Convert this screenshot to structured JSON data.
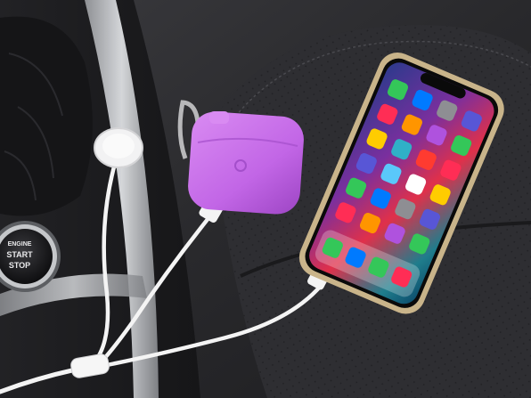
{
  "engine_button": {
    "line1": "ENGINE",
    "line2": "START",
    "line3": "STOP"
  },
  "colors": {
    "seat_leather": "#2a2a2d",
    "console_trim": "#b9bbbe",
    "airpods_case": "#c266e6",
    "phone_frame": "#c9b48a",
    "cable": "#f4f4f4"
  }
}
